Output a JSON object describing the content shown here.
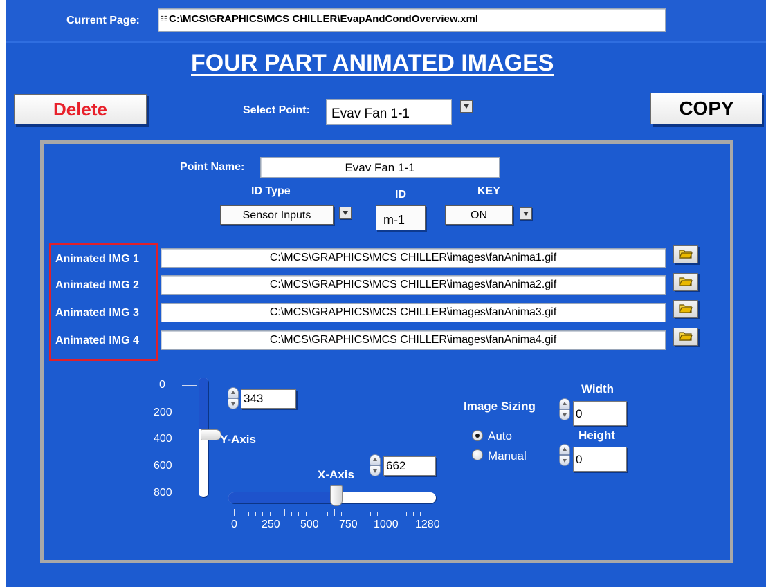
{
  "current_page": {
    "label": "Current Page:",
    "path": "C:\\MCS\\GRAPHICS\\MCS CHILLER\\EvapAndCondOverview.xml"
  },
  "title": "FOUR PART ANIMATED IMAGES",
  "delete_label": "Delete",
  "copy_label": "COPY",
  "select_point": {
    "label": "Select Point:",
    "value": "Evav Fan 1-1"
  },
  "point_name": {
    "label": "Point Name:",
    "value": "Evav Fan 1-1"
  },
  "id_type": {
    "label": "ID Type",
    "value": "Sensor Inputs"
  },
  "id": {
    "label": "ID",
    "value": "m-1"
  },
  "key": {
    "label": "KEY",
    "value": "ON"
  },
  "animated_images": [
    {
      "label": "Animated IMG 1",
      "path": "C:\\MCS\\GRAPHICS\\MCS CHILLER\\images\\fanAnima1.gif"
    },
    {
      "label": "Animated IMG 2",
      "path": "C:\\MCS\\GRAPHICS\\MCS CHILLER\\images\\fanAnima2.gif"
    },
    {
      "label": "Animated IMG 3",
      "path": "C:\\MCS\\GRAPHICS\\MCS CHILLER\\images\\fanAnima3.gif"
    },
    {
      "label": "Animated IMG 4",
      "path": "C:\\MCS\\GRAPHICS\\MCS CHILLER\\images\\fanAnima4.gif"
    }
  ],
  "y_axis": {
    "label": "Y-Axis",
    "value": "343",
    "ticks": [
      "0",
      "200",
      "400",
      "600",
      "800"
    ]
  },
  "x_axis": {
    "label": "X-Axis",
    "value": "662",
    "ticks": [
      "0",
      "250",
      "500",
      "750",
      "1000",
      "1280"
    ]
  },
  "image_sizing": {
    "label": "Image Sizing",
    "options": [
      "Auto",
      "Manual"
    ],
    "selected": "Auto",
    "width_label": "Width",
    "width_value": "0",
    "height_label": "Height",
    "height_value": "0"
  },
  "colors": {
    "background": "#1c5bd0",
    "panel_border": "#a8a8a8",
    "highlight_box": "#e0202a",
    "delete_text": "#e8202a"
  }
}
